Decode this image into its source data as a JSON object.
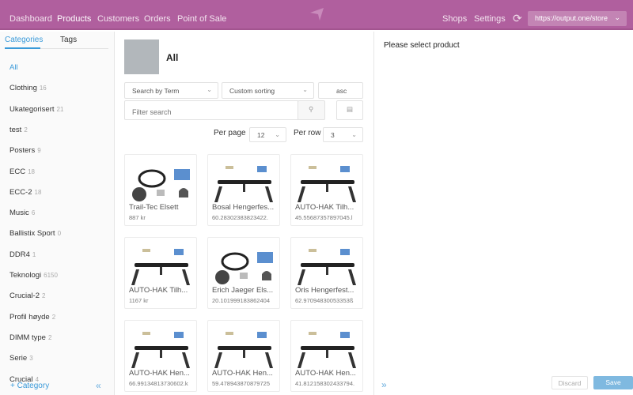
{
  "header": {
    "nav": [
      {
        "label": "Dashboard"
      },
      {
        "label": "Products",
        "active": true
      },
      {
        "label": "Customers"
      },
      {
        "label": "Orders"
      },
      {
        "label": "Point of Sale"
      }
    ],
    "right_nav": [
      {
        "label": "Shops"
      },
      {
        "label": "Settings"
      }
    ],
    "store_url": "https://output.one/store",
    "brand_color": "#b05f9e"
  },
  "sidebar": {
    "tabs": [
      {
        "label": "Categories",
        "active": true
      },
      {
        "label": "Tags"
      }
    ],
    "categories": [
      {
        "label": "All",
        "count": ""
      },
      {
        "label": "Clothing",
        "count": "16"
      },
      {
        "label": "Ukategorisert",
        "count": "21"
      },
      {
        "label": "test",
        "count": "2"
      },
      {
        "label": "Posters",
        "count": "9"
      },
      {
        "label": "ECC",
        "count": "18"
      },
      {
        "label": "ECC-2",
        "count": "18"
      },
      {
        "label": "Music",
        "count": "6"
      },
      {
        "label": "Ballistix Sport",
        "count": "0"
      },
      {
        "label": "DDR4",
        "count": "1"
      },
      {
        "label": "Teknologi",
        "count": "6150"
      },
      {
        "label": "Crucial-2",
        "count": "2"
      },
      {
        "label": "Profil høyde",
        "count": "2"
      },
      {
        "label": "DIMM type",
        "count": "2"
      },
      {
        "label": "Serie",
        "count": "3"
      },
      {
        "label": "Crucial",
        "count": "4"
      }
    ],
    "add_category": "+ Category",
    "accent_color": "#3a9ad9"
  },
  "main": {
    "title": "All",
    "search_by": "Search by Term",
    "sorting": "Custom sorting",
    "order": "asc",
    "search_placeholder": "Filter search",
    "per_page_label": "Per page",
    "per_page": "12",
    "per_row_label": "Per row",
    "per_row": "3",
    "products": [
      {
        "name": "Trail-Tec Elsett",
        "price": "887 kr",
        "kind": "wiring"
      },
      {
        "name": "Bosal Hengerfes...",
        "price": "60.28302383823422.",
        "kind": "hitch"
      },
      {
        "name": "AUTO-HAK Tilh...",
        "price": "45.55687357897045.l",
        "kind": "hitch"
      },
      {
        "name": "AUTO-HAK Tilh...",
        "price": "1167 kr",
        "kind": "hitch"
      },
      {
        "name": "Erich Jaeger Els...",
        "price": "20.10199918386240​4",
        "kind": "wiring"
      },
      {
        "name": "Oris Hengerfest...",
        "price": "62.97094830053353ß",
        "kind": "hitch"
      },
      {
        "name": "AUTO-HAK Hen...",
        "price": "66.99134813730602.k",
        "kind": "hitch"
      },
      {
        "name": "AUTO-HAK Hen...",
        "price": "59.478943870879725",
        "kind": "hitch"
      },
      {
        "name": "AUTO-HAK Hen...",
        "price": "41.81215830243379​4.",
        "kind": "hitch"
      }
    ]
  },
  "detail": {
    "placeholder": "Please select product",
    "discard": "Discard",
    "save": "Save",
    "save_color": "#7fb9e0"
  }
}
